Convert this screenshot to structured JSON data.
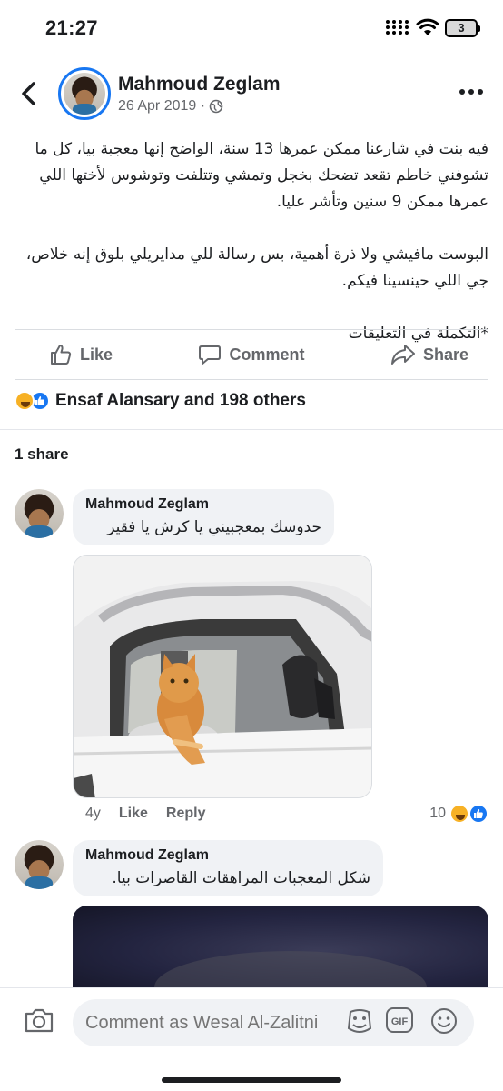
{
  "status_bar": {
    "time": "21:27",
    "battery": "3"
  },
  "post": {
    "author": "Mahmoud Zeglam",
    "date": "26 Apr 2019 · ",
    "paragraphs": [
      "فيه بنت في شارعنا ممكن عمرها 13 سنة، الواضح إنها معجبة بيا، كل ما تشوفني خاطم تقعد تضحك بخجل وتمشي وتتلفت وتوشوس لأختها اللي عمرها ممكن 9 سنين وتأشر عليا.",
      "البوست مافيشي ولا ذرة أهمية، بس رسالة للي مدايريلي بلوق إنه خلاص، جي اللي حينسينا فيكم.",
      "*التكملة في التعليقات"
    ]
  },
  "actions": {
    "like": "Like",
    "comment": "Comment",
    "share": "Share"
  },
  "reactions": {
    "summary": "Ensaf Alansary and 198 others"
  },
  "shares": "1 share",
  "comments": [
    {
      "author": "Mahmoud Zeglam",
      "text": "حدوسك بمعجبيني يا كرش يا فقير",
      "time": "4y",
      "like_label": "Like",
      "reply_label": "Reply",
      "reaction_count": "10"
    },
    {
      "author": "Mahmoud Zeglam",
      "text": "شكل المعجبات المراهقات القاصرات بيا."
    }
  ],
  "composer": {
    "placeholder": "Comment as Wesal Al-Zalitni"
  },
  "colors": {
    "brand": "#1877f2",
    "muted": "#65676b",
    "bubble": "#f0f2f5"
  }
}
